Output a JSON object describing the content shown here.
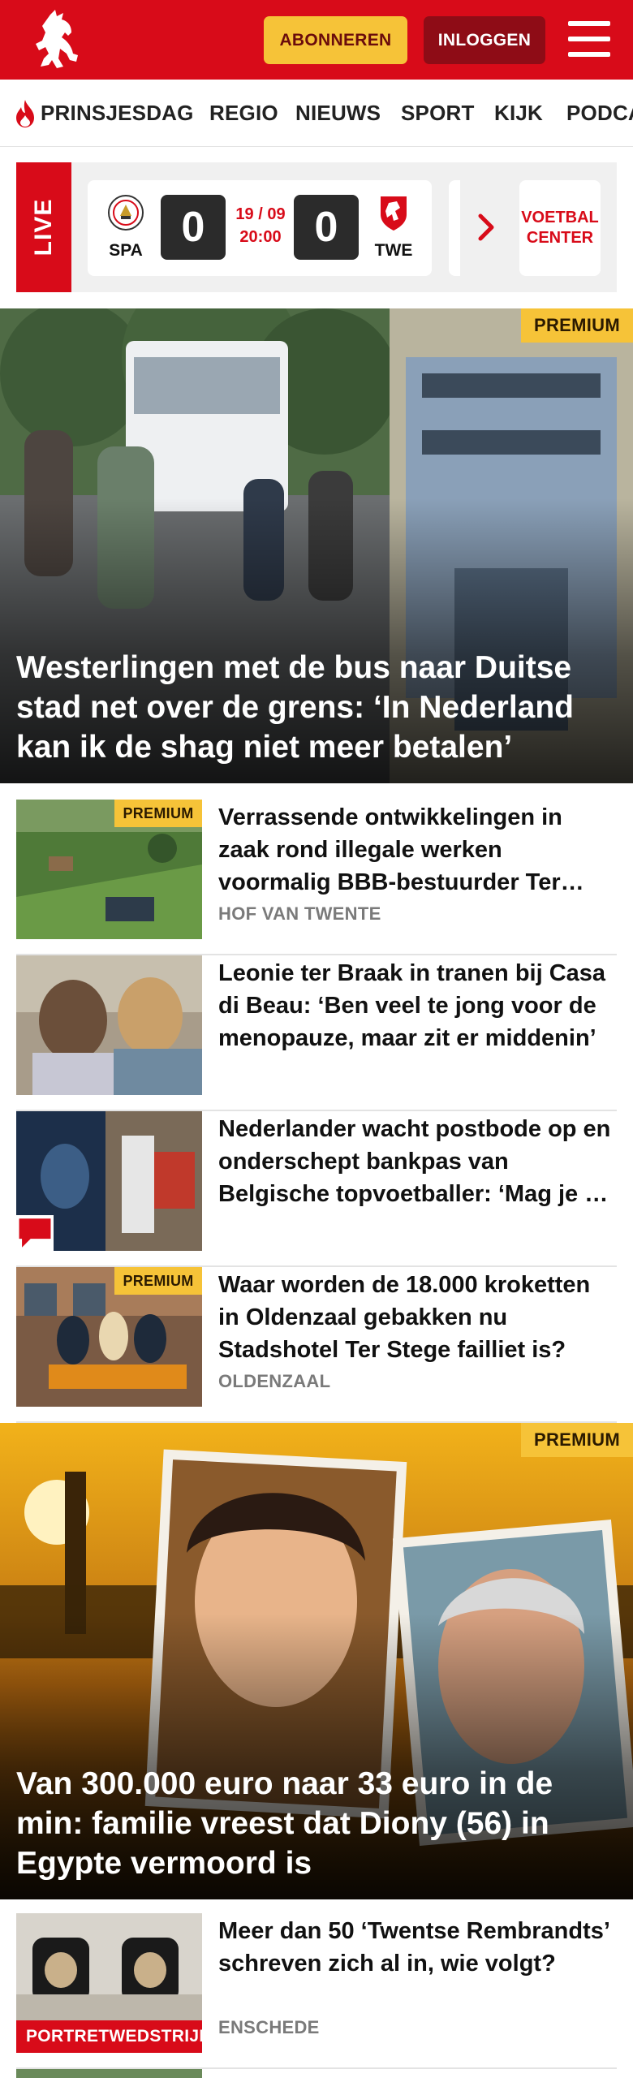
{
  "header": {
    "subscribe_label": "ABONNEREN",
    "login_label": "INLOGGEN",
    "brand_color": "#d80b19",
    "subscribe_color": "#f6c338"
  },
  "nav": {
    "items": [
      {
        "label": "PRINSJESDAG",
        "icon": "flame-icon"
      },
      {
        "label": "REGIO"
      },
      {
        "label": "NIEUWS"
      },
      {
        "label": "SPORT"
      },
      {
        "label": "KIJK"
      },
      {
        "label": "PODCAST"
      }
    ]
  },
  "live": {
    "label": "LIVE",
    "match": {
      "home": "SPA",
      "away": "TWE",
      "home_score": "0",
      "away_score": "0",
      "date": "19 / 09",
      "time": "20:00"
    },
    "voetbal_center_line1": "VOETBAL",
    "voetbal_center_line2": "CENTER"
  },
  "articles": {
    "hero1": {
      "premium": "PREMIUM",
      "title": "Westerlingen met de bus naar Duitse stad net over de grens: ‘In Nederland kan ik de shag niet meer betalen’"
    },
    "list1": [
      {
        "title": "Verrassende ontwikkelingen in zaak rond illegale werken voormalig BBB-bestuurder Ter Heege",
        "premium": "PREMIUM",
        "meta": "HOF VAN TWENTE"
      },
      {
        "title": "Leonie ter Braak in tranen bij Casa di Beau: ‘Ben veel te jong voor de menopauze, maar zit er middenin’"
      },
      {
        "title": "Nederlander wacht postbode op en onderschept bankpas van Belgische topvoetballer: ‘Mag je dit bij ons ook verwachten?’",
        "comment_icon": "comment-icon"
      },
      {
        "title": "Waar worden de 18.000 kroketten in Oldenzaal gebakken nu Stadshotel Ter Stege failliet is?",
        "premium": "PREMIUM",
        "meta": "OLDENZAAL"
      }
    ],
    "hero2": {
      "premium": "PREMIUM",
      "title": "Van 300.000 euro naar 33 euro in de min: familie vreest dat Diony (56) in Egypte vermoord is"
    },
    "list2": [
      {
        "title": "Meer dan 50 ‘Twentse Rembrandts’ schreven zich al in, wie volgt?",
        "meta": "ENSCHEDE",
        "category": "PORTRETWEDSTRIJD"
      }
    ]
  }
}
